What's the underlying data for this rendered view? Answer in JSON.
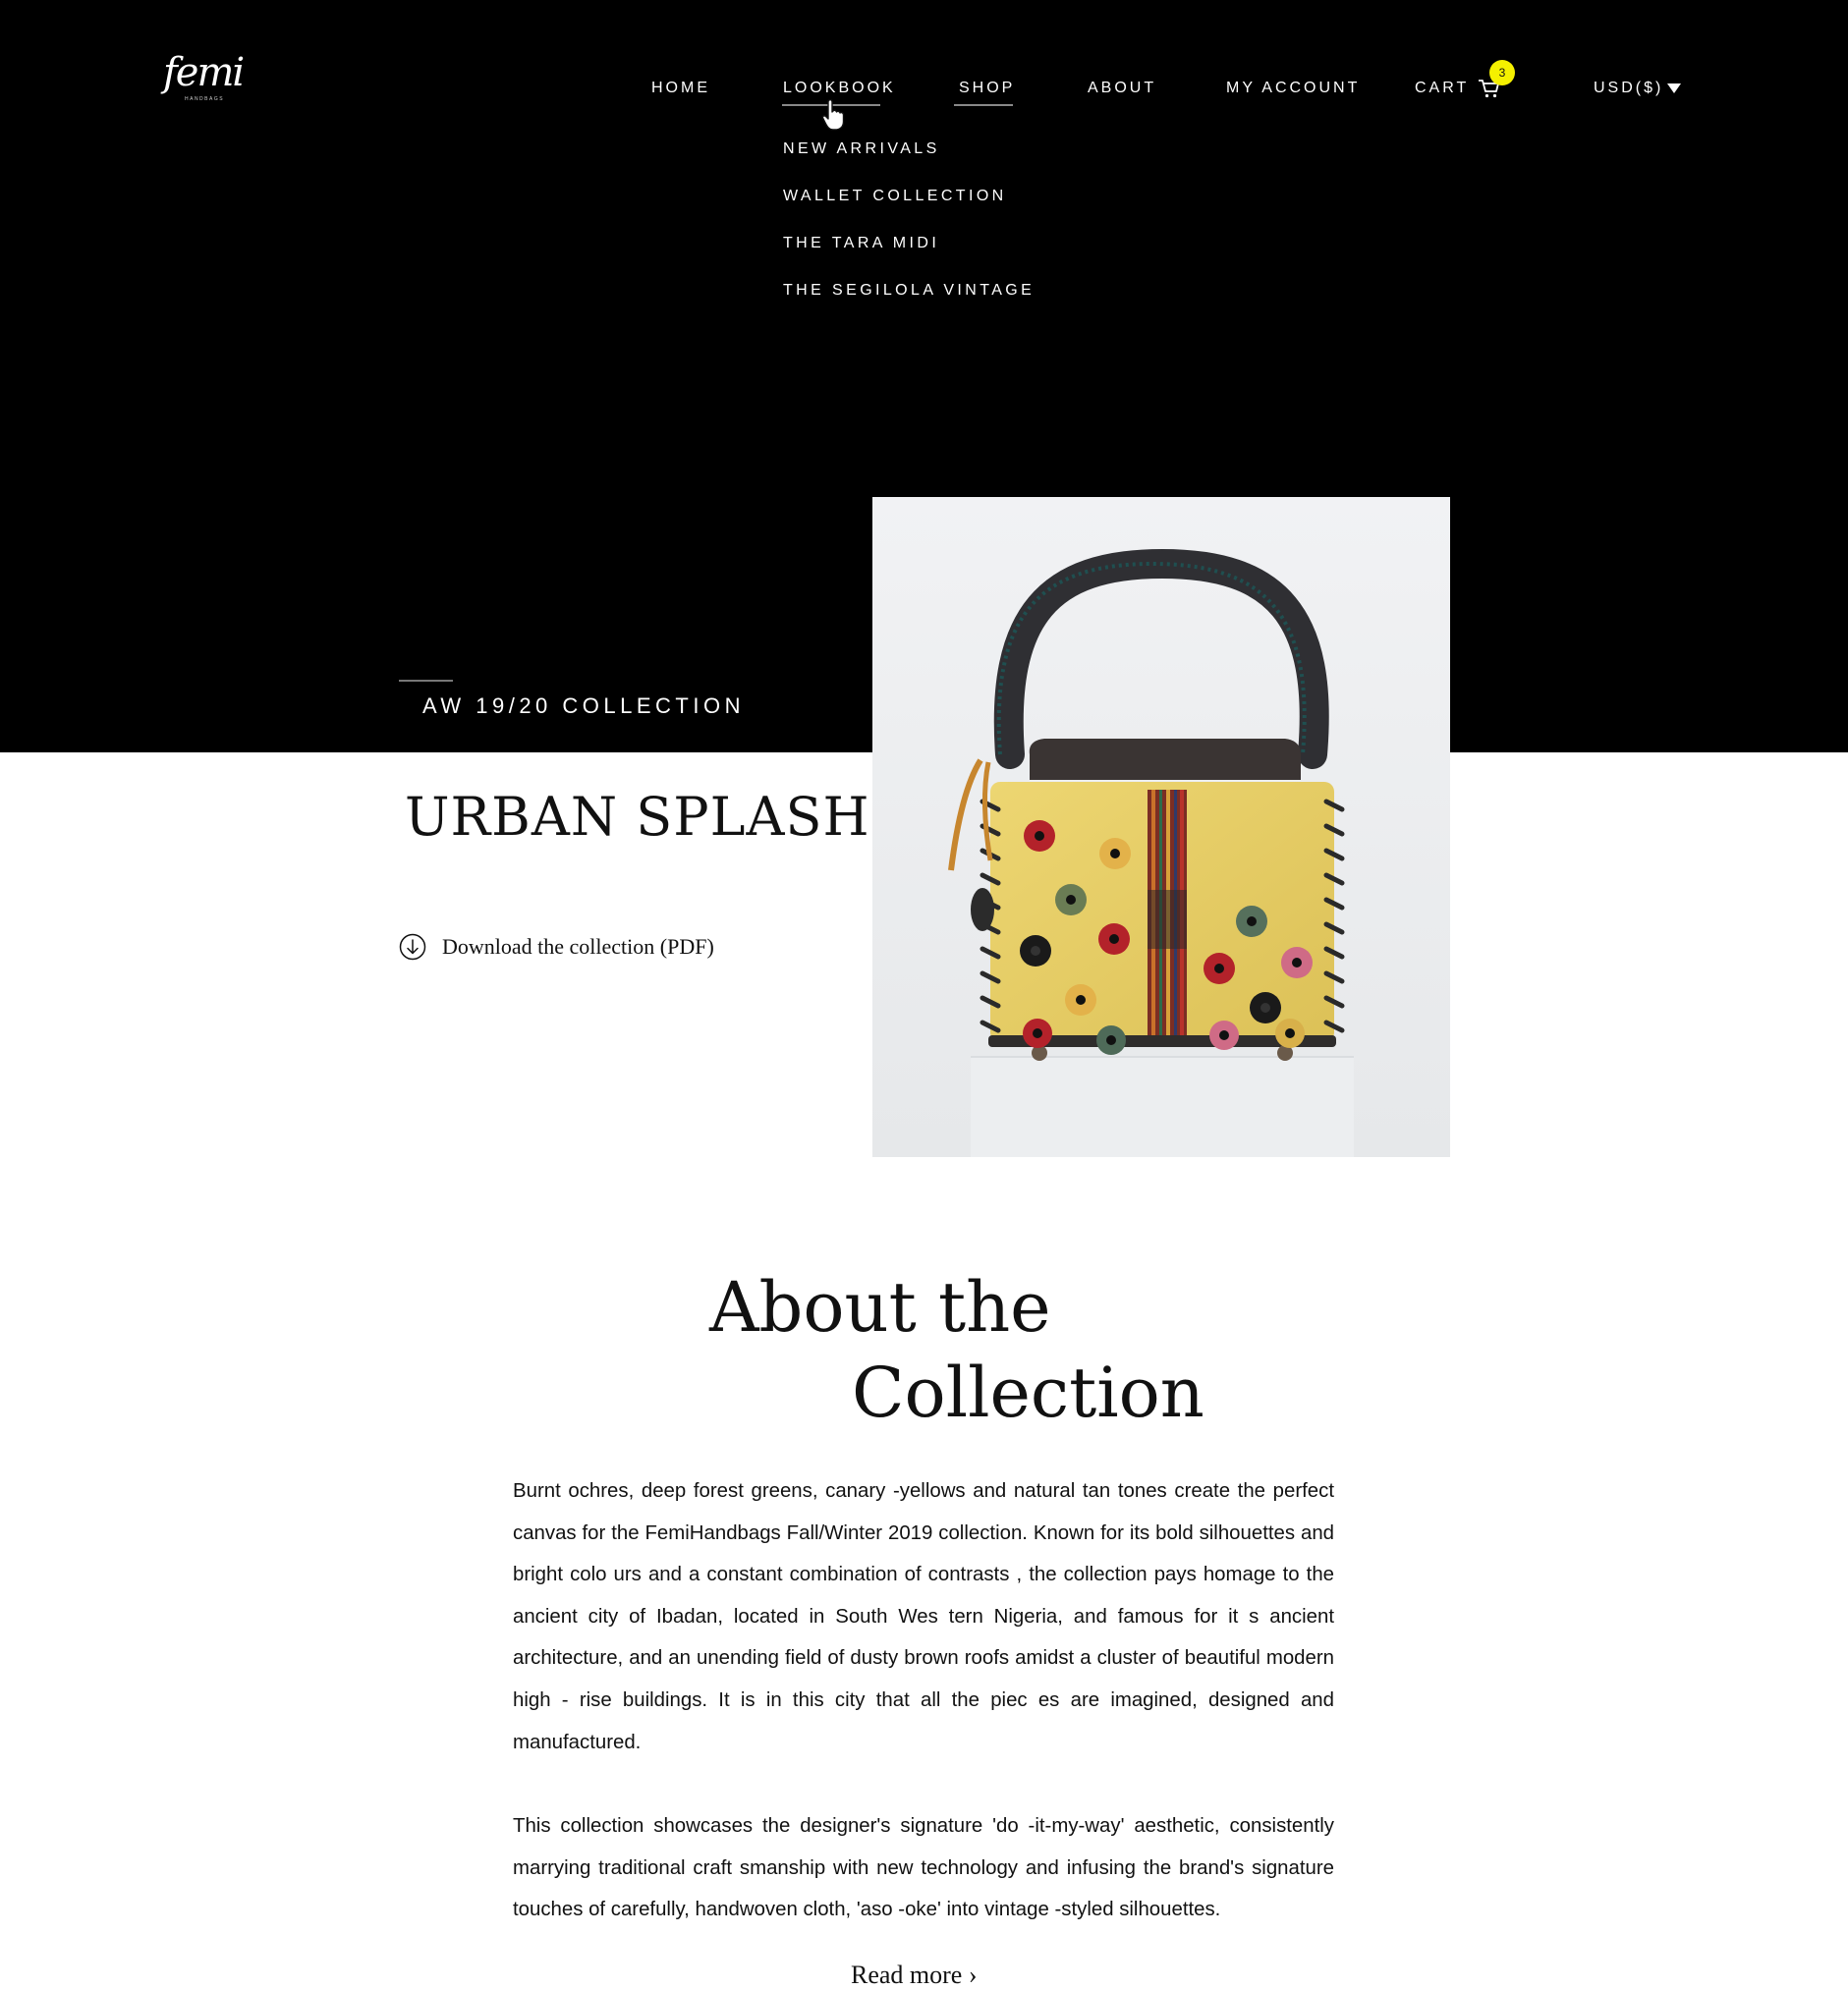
{
  "brand": {
    "logo_text": "femi",
    "logo_subtext": "HANDBAGS"
  },
  "nav": {
    "items": [
      "HOME",
      "LOOKBOOK",
      "SHOP",
      "ABOUT",
      "MY ACCOUNT",
      "CART",
      "USD($)"
    ],
    "cart_count": "3"
  },
  "lookbook_menu": {
    "items": [
      "NEW ARRIVALS",
      "WALLET COLLECTION",
      "THE TARA MIDI",
      "THE SEGILOLA VINTAGE"
    ]
  },
  "collection": {
    "season": "AW 19/20 COLLECTION",
    "title": "URBAN SPLASH",
    "download_label": "Download the collection (PDF)"
  },
  "about": {
    "title_line1": "About the",
    "title_line2": "Collection",
    "paragraph1": "Burnt ochres, deep forest greens, canary -yellows and natural tan tones create the perfect canvas for the FemiHandbags Fall/Winter 2019 collection. Known for its bold silhouettes and bright colo urs and a constant combination of contrasts , the collection pays homage to the ancient city of Ibadan, located in South Wes tern Nigeria, and famous for it s ancient architecture, and an unending field of dusty brown roofs amidst a cluster of beautiful modern high - rise buildings. It is in this city that all the piec es are imagined, designed and manufactured.",
    "paragraph2": "This collection showcases the designer's signature 'do -it-my-way' aesthetic, consistently marrying traditional craft smanship with new technology and infusing the brand's signature touches of carefully, handwoven cloth, 'aso -oke' into vintage -styled silhouettes.",
    "read_more": "Read more"
  },
  "colors": {
    "hero_background": "#000000",
    "cart_badge": "#f5f000",
    "bag_yellow": "#e8cf5e",
    "bag_leather": "#3a3433"
  }
}
